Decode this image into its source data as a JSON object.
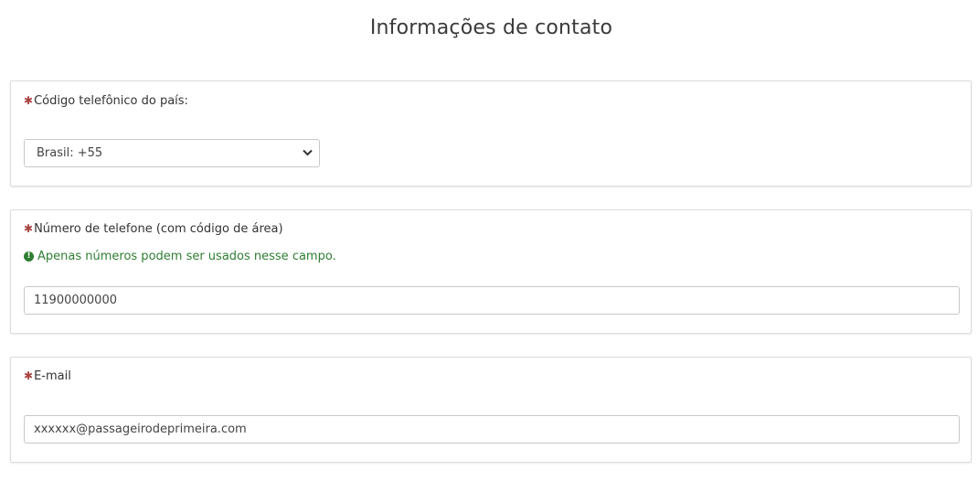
{
  "page": {
    "title": "Informações de contato"
  },
  "required_marker": "✱",
  "country_code": {
    "label": "Código telefônico do país:",
    "selected": "Brasil: +55"
  },
  "phone": {
    "label": "Número de telefone (com código de área)",
    "hint": "Apenas números podem ser usados nesse campo.",
    "value": "11900000000"
  },
  "email": {
    "label": "E-mail",
    "value": "xxxxxx@passageirodeprimeira.com"
  },
  "colors": {
    "required": "#a94442",
    "hint": "#2e7d32",
    "border": "#dcdcdc"
  },
  "icons": {
    "hint_icon": "info-circle-icon",
    "select_icon": "chevron-down-icon"
  }
}
